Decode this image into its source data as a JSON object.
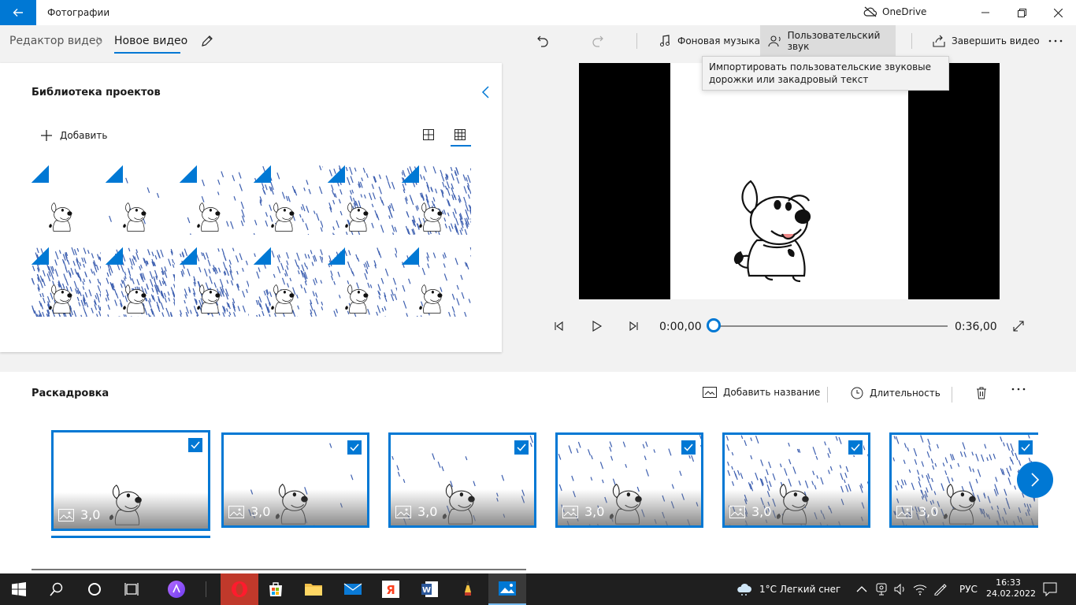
{
  "window": {
    "app_title": "Фотографии",
    "onedrive_label": "OneDrive"
  },
  "breadcrumb": {
    "root": "Редактор видео",
    "current": "Новое видео"
  },
  "toolbar": {
    "music_label": "Фоновая музыка",
    "custom_audio_label": "Пользовательский звук",
    "finish_label": "Завершить видео"
  },
  "tooltip": {
    "text": "Импортировать пользовательские звуковые дорожки или закадровый текст"
  },
  "library": {
    "title": "Библиотека проектов",
    "add_label": "Добавить"
  },
  "player": {
    "current_time": "0:00,00",
    "total_time": "0:36,00",
    "progress": 0
  },
  "storyboard": {
    "title": "Раскадровка",
    "add_title_label": "Добавить название",
    "duration_label": "Длительность",
    "cards": [
      {
        "duration": "3,0"
      },
      {
        "duration": "3,0"
      },
      {
        "duration": "3,0"
      },
      {
        "duration": "3,0"
      },
      {
        "duration": "3,0"
      },
      {
        "duration": "3,0"
      }
    ]
  },
  "taskbar": {
    "weather": "1°C  Легкий снег",
    "language": "РУС",
    "time": "16:33",
    "date": "24.02.2022"
  },
  "colors": {
    "accent": "#0078d4",
    "taskbar": "#1f1f1f"
  }
}
